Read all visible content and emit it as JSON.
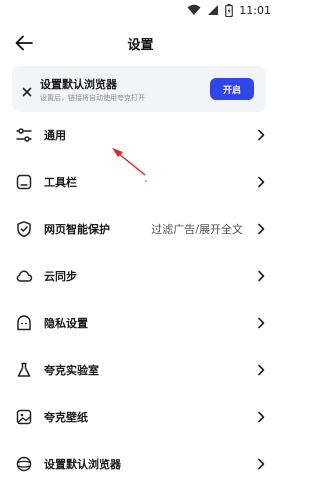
{
  "status_bar": {
    "time": "11:01",
    "icons": [
      "wifi-icon",
      "signal-icon",
      "battery-icon"
    ]
  },
  "header": {
    "title": "设置",
    "back_icon": "back-arrow-icon"
  },
  "banner": {
    "title": "设置默认浏览器",
    "subtitle": "设置后，链接将自动使用夸克打开",
    "button_label": "开启",
    "close_icon": "close-icon"
  },
  "settings": {
    "items": [
      {
        "label": "通用",
        "value": "",
        "icon": "sliders-icon"
      },
      {
        "label": "工具栏",
        "value": "",
        "icon": "toolbar-icon"
      },
      {
        "label": "网页智能保护",
        "value": "过滤广告/展开全文",
        "icon": "shield-check-icon"
      },
      {
        "label": "云同步",
        "value": "",
        "icon": "cloud-icon"
      },
      {
        "label": "隐私设置",
        "value": "",
        "icon": "privacy-icon"
      },
      {
        "label": "夸克实验室",
        "value": "",
        "icon": "flask-icon"
      },
      {
        "label": "夸克壁纸",
        "value": "",
        "icon": "wallpaper-icon"
      },
      {
        "label": "设置默认浏览器",
        "value": "",
        "icon": "browser-icon"
      }
    ]
  },
  "colors": {
    "accent": "#3146e8",
    "banner_bg": "#f3f4f7",
    "annotation_arrow": "#d62b2b"
  }
}
